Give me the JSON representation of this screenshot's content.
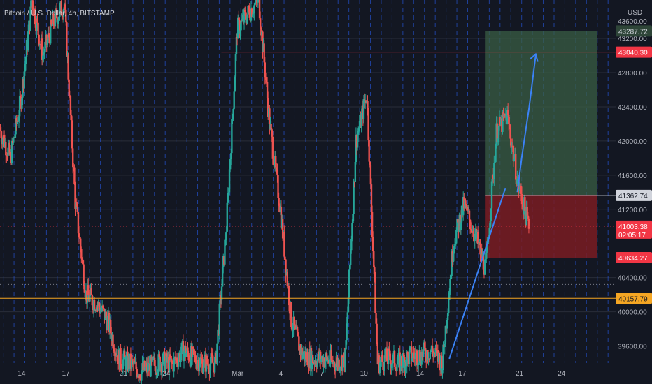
{
  "chart_data": {
    "type": "candlestick",
    "title": "Bitcoin / U.S. Dollar, 4h, BITSTAMP",
    "currency": "USD",
    "y_range": [
      39400,
      43650
    ],
    "x_domain": [
      0,
      57
    ],
    "x_ticks": [
      {
        "label": "14",
        "x": 2.0
      },
      {
        "label": "17",
        "x": 6.1
      },
      {
        "label": "21",
        "x": 11.4
      },
      {
        "label": "24",
        "x": 15.4
      },
      {
        "label": "Mar",
        "x": 22.0
      },
      {
        "label": "4",
        "x": 26.0
      },
      {
        "label": "7",
        "x": 29.8
      },
      {
        "label": "10",
        "x": 33.7
      },
      {
        "label": "14",
        "x": 38.9
      },
      {
        "label": "17",
        "x": 42.8
      },
      {
        "label": "21",
        "x": 48.1
      },
      {
        "label": "24",
        "x": 52.0
      }
    ],
    "y_ticks": [
      39600,
      40000,
      40400,
      41200,
      41600,
      42000,
      42400,
      42800,
      43200
    ],
    "y_tick_labels": [
      "39600.00",
      "40000.00",
      "40400.00",
      "41200.00",
      "41600.00",
      "42000.00",
      "42400.00",
      "42800.00",
      "43200.00"
    ],
    "y_top_partial_label": "43600.00",
    "candles_path": [
      [
        0,
        42150
      ],
      [
        1,
        41800
      ],
      [
        2,
        42500
      ],
      [
        3,
        43650
      ],
      [
        4,
        43000
      ],
      [
        5,
        43400
      ],
      [
        6,
        43600
      ],
      [
        7,
        41300
      ],
      [
        8,
        40200
      ],
      [
        9,
        40100
      ],
      [
        10,
        39900
      ],
      [
        11,
        39450
      ],
      [
        12,
        39400
      ],
      [
        13,
        39300
      ],
      [
        14,
        39350
      ],
      [
        15,
        39420
      ],
      [
        16,
        39380
      ],
      [
        17,
        39550
      ],
      [
        18,
        39450
      ],
      [
        19,
        39400
      ],
      [
        20,
        39400
      ],
      [
        21,
        41000
      ],
      [
        22,
        43300
      ],
      [
        23,
        43500
      ],
      [
        24,
        43650
      ],
      [
        25,
        42200
      ],
      [
        26,
        41200
      ],
      [
        27,
        39900
      ],
      [
        28,
        39500
      ],
      [
        29,
        39450
      ],
      [
        30,
        39450
      ],
      [
        31,
        39400
      ],
      [
        32,
        39450
      ],
      [
        33,
        42000
      ],
      [
        34,
        42550
      ],
      [
        35,
        39400
      ],
      [
        36,
        39450
      ],
      [
        37,
        39400
      ],
      [
        38,
        39480
      ],
      [
        39,
        39500
      ],
      [
        40,
        39550
      ],
      [
        41,
        39400
      ],
      [
        42,
        40800
      ],
      [
        43,
        41250
      ],
      [
        44,
        40900
      ],
      [
        45,
        40500
      ],
      [
        46,
        42100
      ],
      [
        47,
        42300
      ],
      [
        48,
        41500
      ],
      [
        49,
        41000
      ]
    ],
    "levels": [
      {
        "name": "upper-target",
        "value": 43040.3,
        "color": "#f23645",
        "label": "43040.30"
      },
      {
        "name": "support",
        "value": 40157.79,
        "color": "#f5a623",
        "label": "40157.79"
      },
      {
        "name": "current-price",
        "value": 41003.38,
        "color": "#f23645",
        "label": "41003.38",
        "countdown": "02:05:17"
      },
      {
        "name": "dotted-level",
        "value": 40320,
        "color": "#787b86"
      }
    ],
    "position": {
      "entry": 41362.74,
      "target": 43287.72,
      "stop": 40634.27,
      "x_start": 44.9,
      "x_end": 55.3,
      "profit_color": "#3a5d44",
      "loss_color": "#7a1c22"
    },
    "arrow": {
      "color": "#3b82f6",
      "points": [
        [
          41.6,
          39450
        ],
        [
          46.8,
          41450
        ]
      ],
      "path": [
        [
          47.9,
          41400
        ],
        [
          48.3,
          41800
        ],
        [
          49.0,
          42400
        ],
        [
          49.6,
          43000
        ]
      ]
    },
    "tags": [
      {
        "label": "43287.72",
        "value": 43287.72,
        "bg": "#2e4538",
        "fg": "#d1d4dc"
      },
      {
        "label": "43040.30",
        "value": 43040.3,
        "bg": "#f23645",
        "fg": "#ffffff"
      },
      {
        "label": "41362.74",
        "value": 41362.74,
        "bg": "#d1d4dc",
        "fg": "#131722"
      },
      {
        "label": "41003.38",
        "value": 41003.38,
        "bg": "#f23645",
        "fg": "#ffffff",
        "sub": "02:05:17"
      },
      {
        "label": "40634.27",
        "value": 40634.27,
        "bg": "#f23645",
        "fg": "#ffffff"
      },
      {
        "label": "40157.79",
        "value": 40157.79,
        "bg": "#f5a623",
        "fg": "#131722"
      }
    ],
    "colors": {
      "up": "#26a69a",
      "down": "#ef5350",
      "grid_v": "#2962ff",
      "grid_h": "#2a2e39",
      "background": "#131722"
    }
  }
}
